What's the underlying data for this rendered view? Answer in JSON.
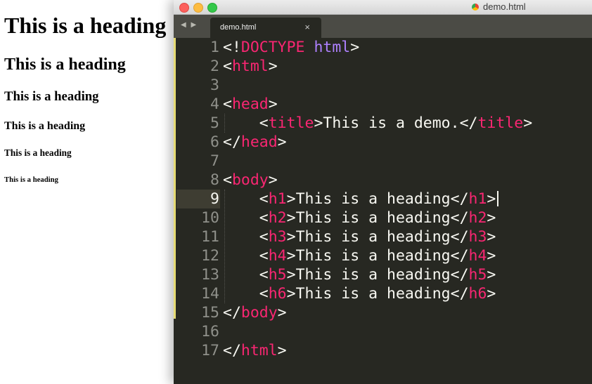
{
  "preview": {
    "h1": "This is a heading",
    "h2": "This is a heading",
    "h3": "This is a heading",
    "h4": "This is a heading",
    "h5": "This is a heading",
    "h6": "This is a heading"
  },
  "window": {
    "title": "demo.html",
    "file_icon": "chrome-file-icon"
  },
  "tabs": [
    {
      "label": "demo.html",
      "close": "×"
    }
  ],
  "nav_arrows": "◀ ▶",
  "editor": {
    "active_line": 9,
    "colors": {
      "background": "#272822",
      "tag": "#f92672",
      "attribute": "#ae81ff",
      "text": "#f8f8f2",
      "line_number": "#8f908a",
      "modified_marker": "#e6db74"
    },
    "line_numbers": [
      "1",
      "2",
      "3",
      "4",
      "5",
      "6",
      "7",
      "8",
      "9",
      "10",
      "11",
      "12",
      "13",
      "14",
      "15",
      "16",
      "17"
    ],
    "lines": [
      [
        "<!",
        "DOCTYPE",
        " ",
        "html",
        ">"
      ],
      [
        "<",
        "html",
        ">"
      ],
      [],
      [
        "<",
        "head",
        ">"
      ],
      [
        "    <",
        "title",
        ">This is a demo.</",
        "title",
        ">"
      ],
      [
        "</",
        "head",
        ">"
      ],
      [],
      [
        "<",
        "body",
        ">"
      ],
      [
        "    <",
        "h1",
        ">This is a heading</",
        "h1",
        ">"
      ],
      [
        "    <",
        "h2",
        ">This is a heading</",
        "h2",
        ">"
      ],
      [
        "    <",
        "h3",
        ">This is a heading</",
        "h3",
        ">"
      ],
      [
        "    <",
        "h4",
        ">This is a heading</",
        "h4",
        ">"
      ],
      [
        "    <",
        "h5",
        ">This is a heading</",
        "h5",
        ">"
      ],
      [
        "    <",
        "h6",
        ">This is a heading</",
        "h6",
        ">"
      ],
      [
        "</",
        "body",
        ">"
      ],
      [],
      [
        "</",
        "html",
        ">"
      ]
    ]
  }
}
